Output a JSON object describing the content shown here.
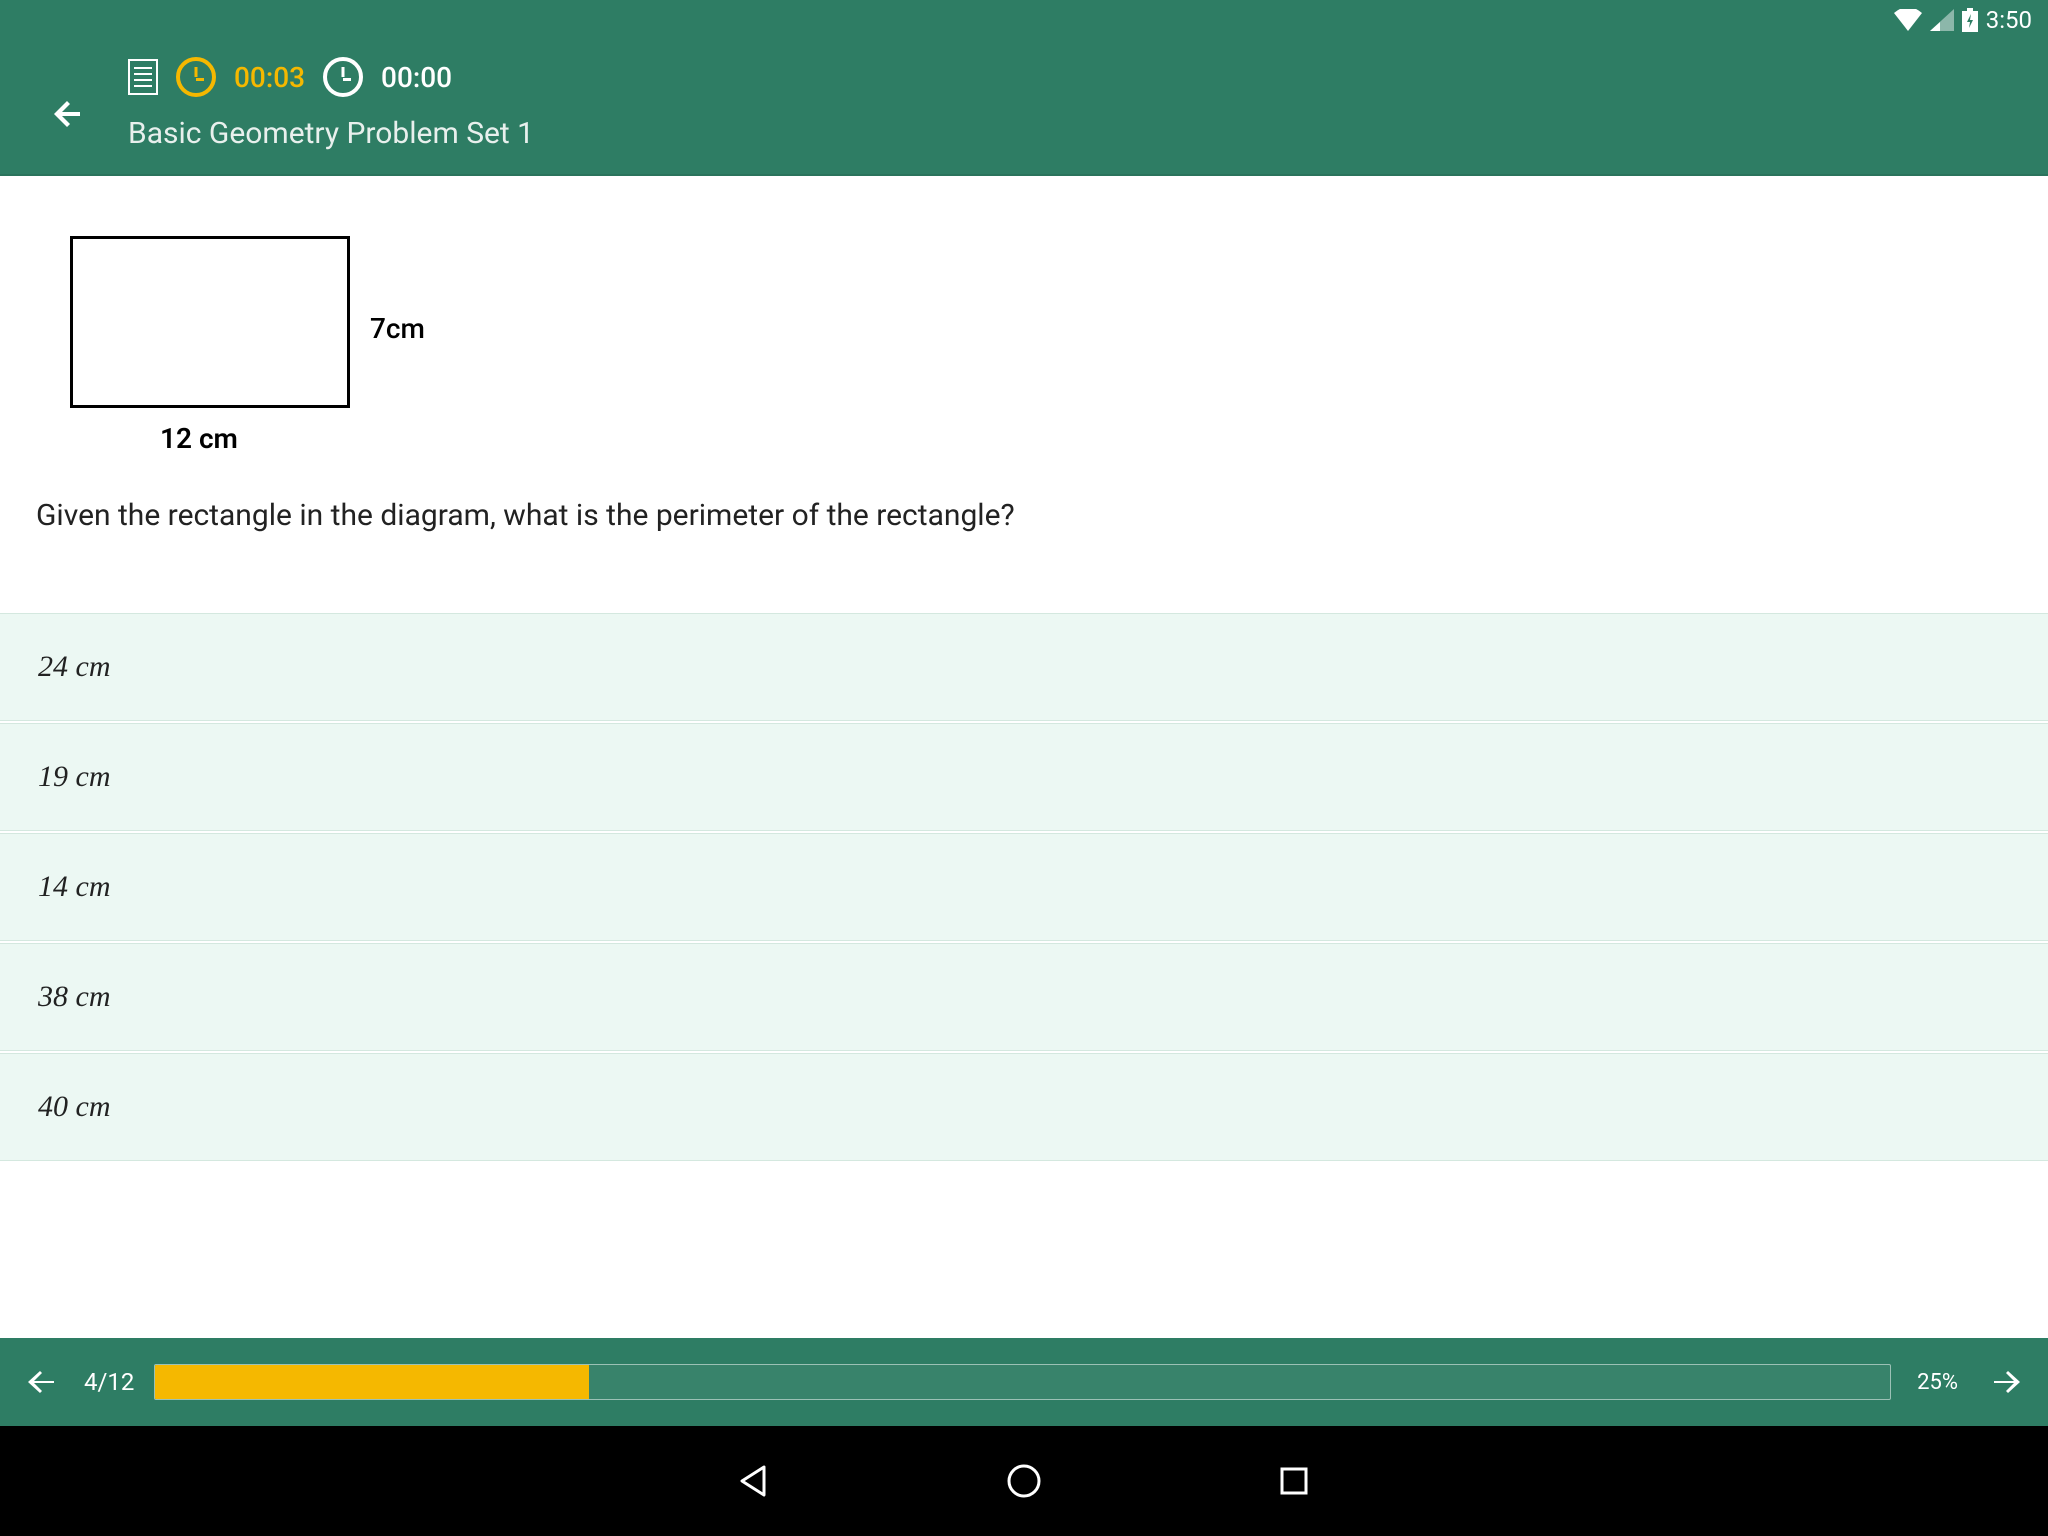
{
  "status": {
    "time": "3:50"
  },
  "header": {
    "timer_elapsed": "00:03",
    "timer_remaining": "00:00",
    "title": "Basic Geometry Problem Set 1"
  },
  "diagram": {
    "width_label": "12 cm",
    "height_label": "7cm"
  },
  "question": "Given the rectangle in the diagram, what is the perimeter of the rectangle?",
  "answers": [
    "24 cm",
    "19 cm",
    "14 cm",
    "38 cm",
    "40 cm"
  ],
  "footer": {
    "page_indicator": "4/12",
    "progress_percent": 25,
    "percent_label": "25%"
  }
}
